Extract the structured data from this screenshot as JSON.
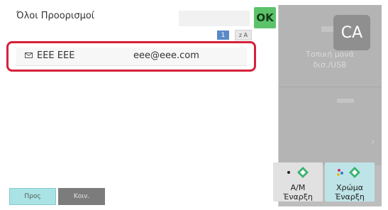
{
  "destinations": {
    "title": "Όλοι Προορισμοί",
    "ok_label": "OK",
    "page_number": "1",
    "sort_label": "z A",
    "entries": [
      {
        "name": "EEE EEE",
        "email": "eee@eee.com"
      }
    ]
  },
  "tabs": {
    "to_label": "Προς",
    "common_label": "Κοιν."
  },
  "right_panel": {
    "ghost_text_line1": "Τοπική μονά",
    "ghost_text_line2": "δισ./USB",
    "ca_label": "CA",
    "start_bw_line1": "Α/Μ",
    "start_bw_line2": "Έναρξη",
    "start_color_line1": "Χρώμα",
    "start_color_line2": "Έναρξη"
  },
  "colors": {
    "highlight": "#d6213a",
    "ok": "#5cc36a",
    "start_icon": "#3cb371"
  }
}
